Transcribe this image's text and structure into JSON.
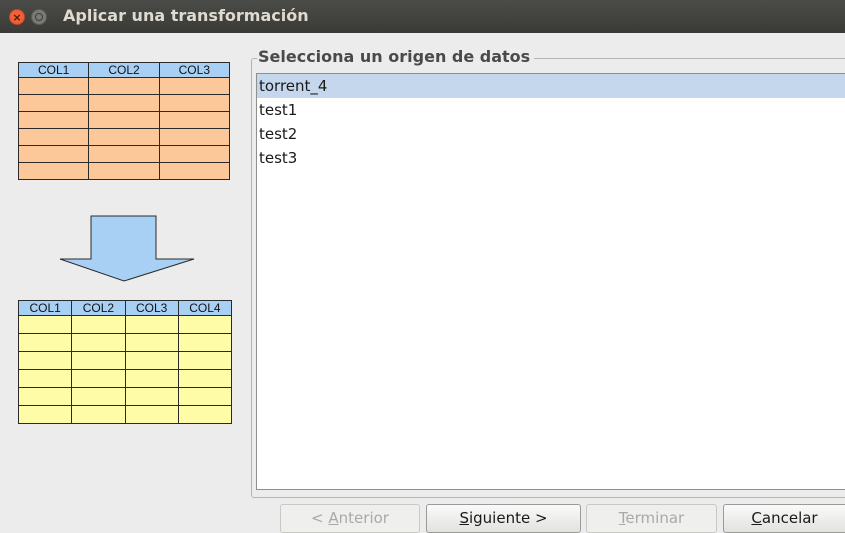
{
  "window": {
    "title": "Aplicar una transformación",
    "close_glyph": "×"
  },
  "illustration": {
    "source_table": {
      "headers": [
        "COL1",
        "COL2",
        "COL3"
      ],
      "row_count": 6,
      "cell_color": "#fcc899"
    },
    "target_table": {
      "headers": [
        "COL1",
        "COL2",
        "COL3",
        "COL4"
      ],
      "row_count": 6,
      "cell_color": "#fffca8"
    },
    "header_color": "#a8d0f5",
    "arrow_color": "#a8d0f5",
    "arrow_icon": "down-arrow-icon"
  },
  "data_source": {
    "legend": "Selecciona un origen de datos",
    "items": [
      {
        "label": "torrent_4",
        "selected": true
      },
      {
        "label": "test1",
        "selected": false
      },
      {
        "label": "test2",
        "selected": false
      },
      {
        "label": "test3",
        "selected": false
      }
    ],
    "selection_color": "#c5d7ec"
  },
  "buttons": {
    "previous": {
      "prefix": "< ",
      "mnemonic": "A",
      "rest": "nterior",
      "enabled": false
    },
    "next": {
      "mnemonic": "S",
      "rest": "iguiente >",
      "enabled": true
    },
    "finish": {
      "mnemonic": "T",
      "rest": "erminar",
      "enabled": false
    },
    "cancel": {
      "mnemonic": "C",
      "rest": "ancelar",
      "enabled": true
    }
  }
}
